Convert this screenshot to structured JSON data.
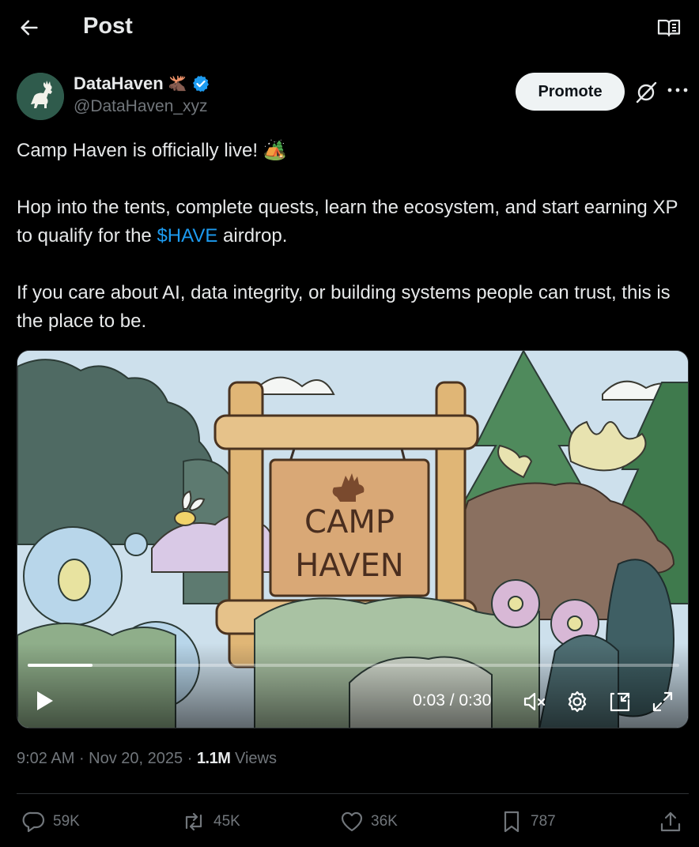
{
  "header": {
    "title": "Post",
    "back_icon": "arrow-left-icon",
    "reader_icon": "book-open-icon"
  },
  "author": {
    "display_name": "DataHaven",
    "name_emoji": "🫎",
    "handle": "@DataHaven_xyz",
    "verified": true,
    "avatar_icon": "deer-logo-icon"
  },
  "toolbar": {
    "promote_label": "Promote"
  },
  "post": {
    "line1": "Camp Haven is officially live! 🏕️",
    "line2_part1": "Hop into the tents, complete quests, learn the ecosystem, and start earning XP to qualify for the ",
    "cashtag": "$HAVE",
    "line2_part2": " airdrop.",
    "line3": "If you care about AI, data integrity, or building systems people can trust, this is the place to be."
  },
  "video": {
    "sign_line1": "CAMP",
    "sign_line2": "HAVEN",
    "time_label": "0:03 / 0:30",
    "progress_fraction": 0.1
  },
  "meta": {
    "time": "9:02 AM",
    "separator": " · ",
    "date": "Nov 20, 2025",
    "views_count": "1.1M",
    "views_label": " Views"
  },
  "actions": {
    "replies": "59K",
    "reposts": "45K",
    "likes": "36K",
    "bookmarks": "787"
  },
  "colors": {
    "accent": "#1d9bf0",
    "background": "#000000",
    "muted": "#71767b"
  }
}
